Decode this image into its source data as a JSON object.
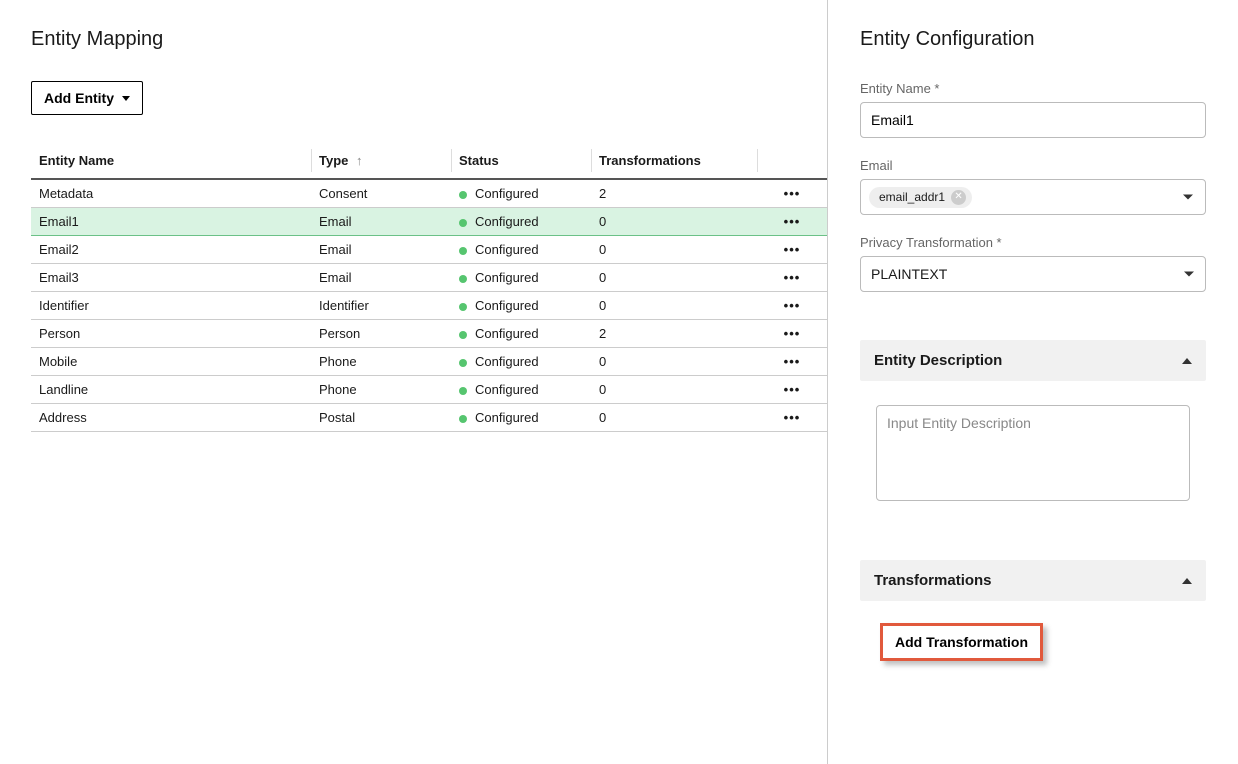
{
  "left": {
    "title": "Entity Mapping",
    "add_button": "Add Entity",
    "columns": {
      "name": "Entity Name",
      "type": "Type",
      "status": "Status",
      "transformations": "Transformations"
    },
    "rows": [
      {
        "name": "Metadata",
        "type": "Consent",
        "status": "Configured",
        "transformations": "2",
        "selected": false
      },
      {
        "name": "Email1",
        "type": "Email",
        "status": "Configured",
        "transformations": "0",
        "selected": true
      },
      {
        "name": "Email2",
        "type": "Email",
        "status": "Configured",
        "transformations": "0",
        "selected": false
      },
      {
        "name": "Email3",
        "type": "Email",
        "status": "Configured",
        "transformations": "0",
        "selected": false
      },
      {
        "name": "Identifier",
        "type": "Identifier",
        "status": "Configured",
        "transformations": "0",
        "selected": false
      },
      {
        "name": "Person",
        "type": "Person",
        "status": "Configured",
        "transformations": "2",
        "selected": false
      },
      {
        "name": "Mobile",
        "type": "Phone",
        "status": "Configured",
        "transformations": "0",
        "selected": false
      },
      {
        "name": "Landline",
        "type": "Phone",
        "status": "Configured",
        "transformations": "0",
        "selected": false
      },
      {
        "name": "Address",
        "type": "Postal",
        "status": "Configured",
        "transformations": "0",
        "selected": false
      }
    ]
  },
  "right": {
    "title": "Entity Configuration",
    "entity_name_label": "Entity Name",
    "entity_name_value": "Email1",
    "email_label": "Email",
    "email_chip": "email_addr1",
    "privacy_label": "Privacy Transformation",
    "privacy_value": "PLAINTEXT",
    "desc_section": "Entity Description",
    "desc_placeholder": "Input Entity Description",
    "trans_section": "Transformations",
    "add_trans_button": "Add Transformation"
  }
}
